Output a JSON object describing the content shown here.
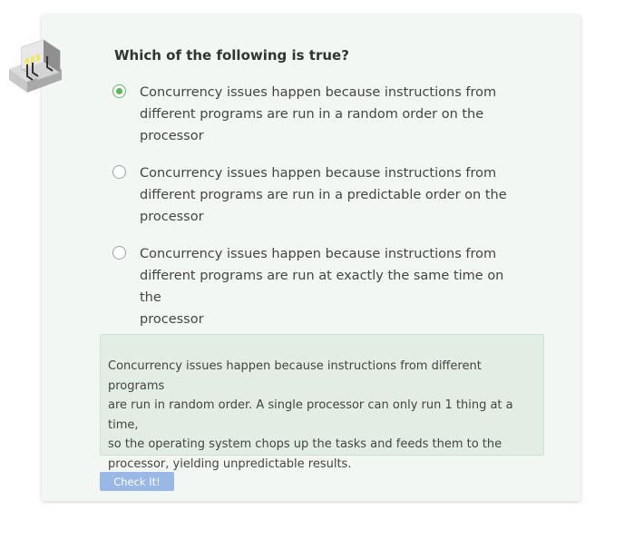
{
  "quiz": {
    "logo_icon": "processor-cube-icon",
    "question": "Which of the following is true?",
    "options": [
      {
        "line1": "Concurrency issues happen because instructions from",
        "line2": "different programs are run in a random order on the",
        "line3": "processor",
        "selected": true
      },
      {
        "line1": "Concurrency issues happen because instructions from",
        "line2": "different programs are run in a predictable order on the",
        "line3": "processor",
        "selected": false
      },
      {
        "line1": "Concurrency issues happen because instructions from",
        "line2": "different programs are run at exactly the same time on the",
        "line3": "processor",
        "selected": false
      }
    ],
    "explanation": {
      "line1": "Concurrency issues happen because instructions from different programs",
      "line2": "are run in random order. A single processor can only run 1 thing at a time,",
      "line3": "so the operating system chops up the tasks and feeds them to the",
      "line4": "processor, yielding unpredictable results."
    },
    "check_button_label": "Check It!"
  },
  "colors": {
    "card_background": "#f3f7f3",
    "explanation_background": "#e2ede3",
    "selected_radio": "#5cb85c",
    "button_background": "#9ab8e6"
  }
}
